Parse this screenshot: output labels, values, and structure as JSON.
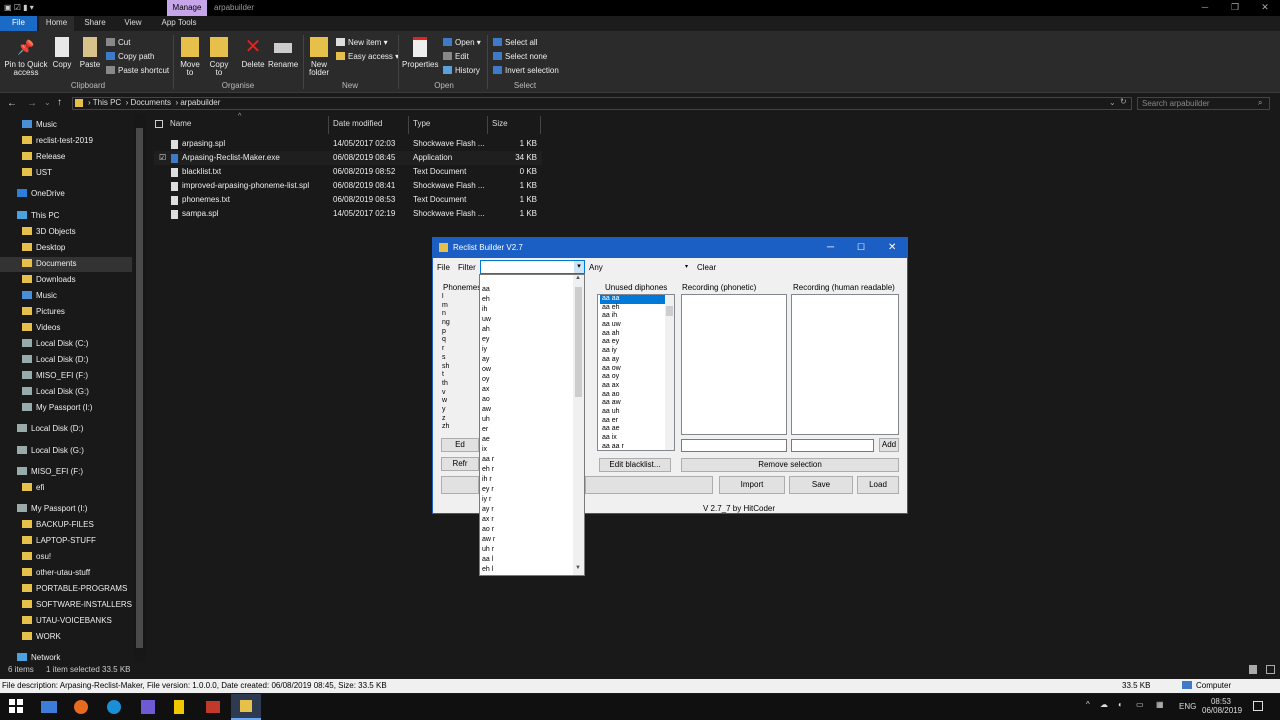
{
  "window": {
    "tab_manage": "Manage",
    "title": "arpabuilder"
  },
  "ribbon": {
    "tabs": [
      "File",
      "Home",
      "Share",
      "View",
      "App Tools"
    ],
    "clipboard": {
      "pin": "Pin to Quick access",
      "copy": "Copy",
      "paste": "Paste",
      "cut": "Cut",
      "copy_path": "Copy path",
      "paste_shortcut": "Paste shortcut",
      "label": "Clipboard"
    },
    "organise": {
      "move": "Move to",
      "copy": "Copy to",
      "delete": "Delete",
      "rename": "Rename",
      "label": "Organise"
    },
    "new": {
      "new_folder": "New folder",
      "new_item": "New item",
      "easy_access": "Easy access",
      "label": "New"
    },
    "open": {
      "properties": "Properties",
      "open": "Open",
      "edit": "Edit",
      "history": "History",
      "label": "Open"
    },
    "select": {
      "select_all": "Select all",
      "select_none": "Select none",
      "invert": "Invert selection",
      "label": "Select"
    }
  },
  "address": {
    "crumbs": [
      "This PC",
      "Documents",
      "arpabuilder"
    ],
    "search_placeholder": "Search arpabuilder"
  },
  "nav": [
    {
      "label": "Music",
      "icon": "music"
    },
    {
      "label": "reclist-test-2019",
      "icon": "folder"
    },
    {
      "label": "Release",
      "icon": "folder"
    },
    {
      "label": "UST",
      "icon": "folder"
    },
    {
      "label": "OneDrive",
      "icon": "cloud"
    },
    {
      "label": "This PC",
      "icon": "pc"
    },
    {
      "label": "3D Objects",
      "icon": "folder"
    },
    {
      "label": "Desktop",
      "icon": "folder"
    },
    {
      "label": "Documents",
      "icon": "folder"
    },
    {
      "label": "Downloads",
      "icon": "folder"
    },
    {
      "label": "Music",
      "icon": "music"
    },
    {
      "label": "Pictures",
      "icon": "folder"
    },
    {
      "label": "Videos",
      "icon": "folder"
    },
    {
      "label": "Local Disk (C:)",
      "icon": "drive"
    },
    {
      "label": "Local Disk (D:)",
      "icon": "drive"
    },
    {
      "label": "MISO_EFI (F:)",
      "icon": "drive"
    },
    {
      "label": "Local Disk (G:)",
      "icon": "drive"
    },
    {
      "label": "My Passport (I:)",
      "icon": "drive"
    },
    {
      "label": "Local Disk (D:)",
      "icon": "drive"
    },
    {
      "label": "Local Disk (G:)",
      "icon": "drive"
    },
    {
      "label": "MISO_EFI (F:)",
      "icon": "drive"
    },
    {
      "label": "efi",
      "icon": "folder"
    },
    {
      "label": "My Passport (I:)",
      "icon": "drive"
    },
    {
      "label": "BACKUP-FILES",
      "icon": "folder"
    },
    {
      "label": "LAPTOP-STUFF",
      "icon": "folder"
    },
    {
      "label": "osu!",
      "icon": "folder"
    },
    {
      "label": "other-utau-stuff",
      "icon": "folder"
    },
    {
      "label": "PORTABLE-PROGRAMS",
      "icon": "folder"
    },
    {
      "label": "SOFTWARE-INSTALLERS",
      "icon": "folder"
    },
    {
      "label": "UTAU-VOICEBANKS",
      "icon": "folder"
    },
    {
      "label": "WORK",
      "icon": "folder"
    },
    {
      "label": "Network",
      "icon": "network"
    }
  ],
  "columns": [
    "Name",
    "Date modified",
    "Type",
    "Size"
  ],
  "files": [
    {
      "name": "arpasing.spl",
      "date": "14/05/2017 02:03",
      "type": "Shockwave Flash ...",
      "size": "1 KB"
    },
    {
      "name": "Arpasing-Reclist-Maker.exe",
      "date": "06/08/2019 08:45",
      "type": "Application",
      "size": "34 KB"
    },
    {
      "name": "blacklist.txt",
      "date": "06/08/2019 08:52",
      "type": "Text Document",
      "size": "0 KB"
    },
    {
      "name": "improved-arpasing-phoneme-list.spl",
      "date": "06/08/2019 08:41",
      "type": "Shockwave Flash ...",
      "size": "1 KB"
    },
    {
      "name": "phonemes.txt",
      "date": "06/08/2019 08:53",
      "type": "Text Document",
      "size": "1 KB"
    },
    {
      "name": "sampa.spl",
      "date": "14/05/2017 02:19",
      "type": "Shockwave Flash ...",
      "size": "1 KB"
    }
  ],
  "status": {
    "count": "6 items",
    "selected": "1 item selected  33.5 KB"
  },
  "details": {
    "text": "File description: Arpasing-Reclist-Maker, File version: 1.0.0.0, Date created: 06/08/2019 08:45, Size: 33.5 KB",
    "size": "33.5 KB",
    "location": "Computer"
  },
  "taskbar": {
    "lang": "ENG",
    "time": "08:53",
    "date": "06/08/2019"
  },
  "dialog": {
    "title": "Reclist Builder V2.7",
    "menu_file": "File",
    "filter_label": "Filter",
    "filter_value": "",
    "any": "Any",
    "clear": "Clear",
    "phonemes_label": "Phonemes",
    "unused_label": "Unused diphones",
    "rec_phonetic": "Recording (phonetic)",
    "rec_human": "Recording (human readable)",
    "phonemes": [
      "l",
      "m",
      "n",
      "ng",
      "p",
      "q",
      "r",
      "s",
      "sh",
      "t",
      "th",
      "v",
      "w",
      "y",
      "z",
      "zh"
    ],
    "unused": [
      "aa aa",
      "aa eh",
      "aa ih",
      "aa uw",
      "aa ah",
      "aa ey",
      "aa iy",
      "aa ay",
      "aa ow",
      "aa oy",
      "aa ax",
      "aa ao",
      "aa aw",
      "aa uh",
      "aa er",
      "aa ae",
      "aa ix",
      "aa aa r"
    ],
    "add": "Add",
    "edit_blacklist": "Edit blacklist...",
    "remove_selection": "Remove selection",
    "import": "Import",
    "save": "Save",
    "load": "Load",
    "edit_partial": "Ed",
    "refresh_partial": "Refr",
    "version": "V 2.7_7 by HitCoder",
    "dropdown": [
      "aa",
      "eh",
      "ih",
      "uw",
      "ah",
      "ey",
      "iy",
      "ay",
      "ow",
      "oy",
      "ax",
      "ao",
      "aw",
      "uh",
      "er",
      "ae",
      "ix",
      "aa r",
      "eh r",
      "ih r",
      "ey r",
      "iy r",
      "ay r",
      "ax r",
      "ao r",
      "aw r",
      "uh r",
      "aa l",
      "eh l"
    ]
  }
}
